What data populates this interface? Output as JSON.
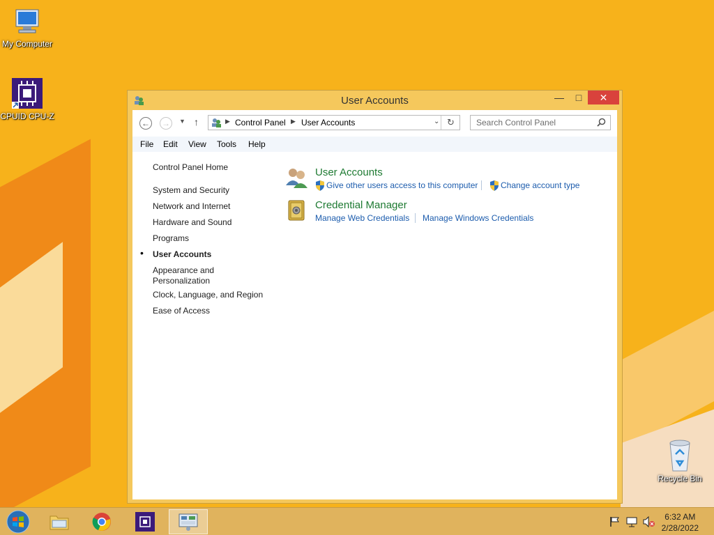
{
  "desktop": {
    "icons": [
      {
        "label": "My Computer"
      },
      {
        "label": "CPUID CPU-Z"
      },
      {
        "label": "Recycle Bin"
      }
    ]
  },
  "window": {
    "title": "User Accounts",
    "controls": {
      "minimize": "—",
      "maximize": "□",
      "close": "✕"
    },
    "address": {
      "crumbs": [
        "Control Panel",
        "User Accounts"
      ]
    },
    "search": {
      "placeholder": "Search Control Panel"
    },
    "menu": [
      "File",
      "Edit",
      "View",
      "Tools",
      "Help"
    ],
    "left_nav": {
      "home": "Control Panel Home",
      "items": [
        "System and Security",
        "Network and Internet",
        "Hardware and Sound",
        "Programs",
        "User Accounts",
        "Appearance and",
        "Personalization",
        "Clock, Language, and Region",
        "Ease of Access"
      ],
      "selected": "User Accounts"
    },
    "categories": [
      {
        "title": "User Accounts",
        "links": [
          "Give other users access to this computer",
          "Change account type"
        ]
      },
      {
        "title": "Credential Manager",
        "links": [
          "Manage Web Credentials",
          "Manage Windows Credentials"
        ]
      }
    ]
  },
  "taskbar": {
    "clock": {
      "time": "6:32 AM",
      "date": "2/28/2022"
    }
  },
  "colors": {
    "desktop": "#f7b21b",
    "window_frame": "#f5c85c",
    "link": "#1c5cad",
    "category_title": "#1e7a32",
    "close": "#d9423c"
  }
}
